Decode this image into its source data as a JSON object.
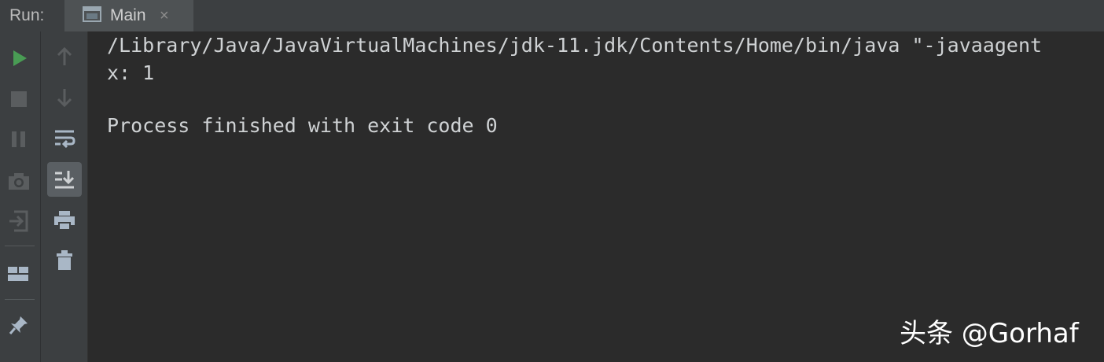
{
  "header": {
    "run_label": "Run:",
    "tab_label": "Main",
    "tab_close": "×"
  },
  "toolbar_left": {
    "buttons": [
      "rerun-icon",
      "stop-icon",
      "pause-icon",
      "camera-icon",
      "exit-icon",
      "layout-icon",
      "pin-icon"
    ]
  },
  "toolbar_right": {
    "buttons": [
      "up-arrow-icon",
      "down-arrow-icon",
      "soft-wrap-icon",
      "scroll-to-end-icon",
      "print-icon",
      "trash-icon"
    ]
  },
  "console": {
    "lines": [
      "/Library/Java/JavaVirtualMachines/jdk-11.jdk/Contents/Home/bin/java \"-javaagent",
      "x: 1",
      "",
      "Process finished with exit code 0"
    ]
  },
  "watermark": "头条 @Gorhaf",
  "colors": {
    "background": "#2b2b2b",
    "panel": "#3c3f41",
    "text": "#cfd2d4",
    "run_green": "#499c54"
  }
}
